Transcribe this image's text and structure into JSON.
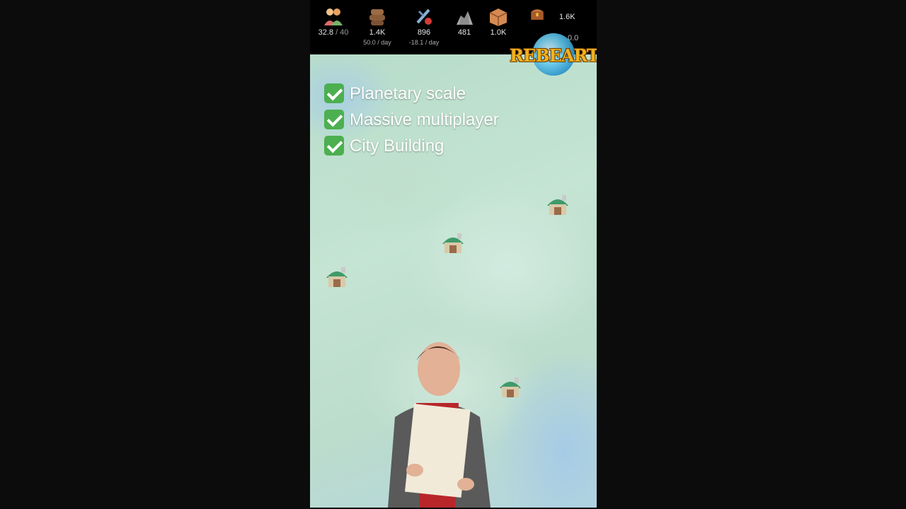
{
  "hud": {
    "resources": [
      {
        "icon": "population-icon",
        "value": "32.8",
        "cap": "/ 40",
        "sub": ""
      },
      {
        "icon": "wood-logs-icon",
        "value": "1.4K",
        "cap": "",
        "sub": "50.0 / day"
      },
      {
        "icon": "food-icon",
        "value": "896",
        "cap": "",
        "sub": "-18.1 / day"
      },
      {
        "icon": "stone-icon",
        "value": "481",
        "cap": "",
        "sub": ""
      },
      {
        "icon": "crate-icon",
        "value": "1.0K",
        "cap": "",
        "sub": ""
      },
      {
        "icon": "gold-chest-icon",
        "value": "1.6K",
        "cap": "",
        "sub": ""
      }
    ],
    "partial_value": "0.0"
  },
  "logo": {
    "text": "REBEARTH"
  },
  "features": [
    {
      "label": "Planetary scale"
    },
    {
      "label": "Massive multiplayer"
    },
    {
      "label": "City Building"
    }
  ],
  "colors": {
    "check": "#4caf50",
    "logo": "#f0b21e",
    "map": "#c5e4d3"
  }
}
